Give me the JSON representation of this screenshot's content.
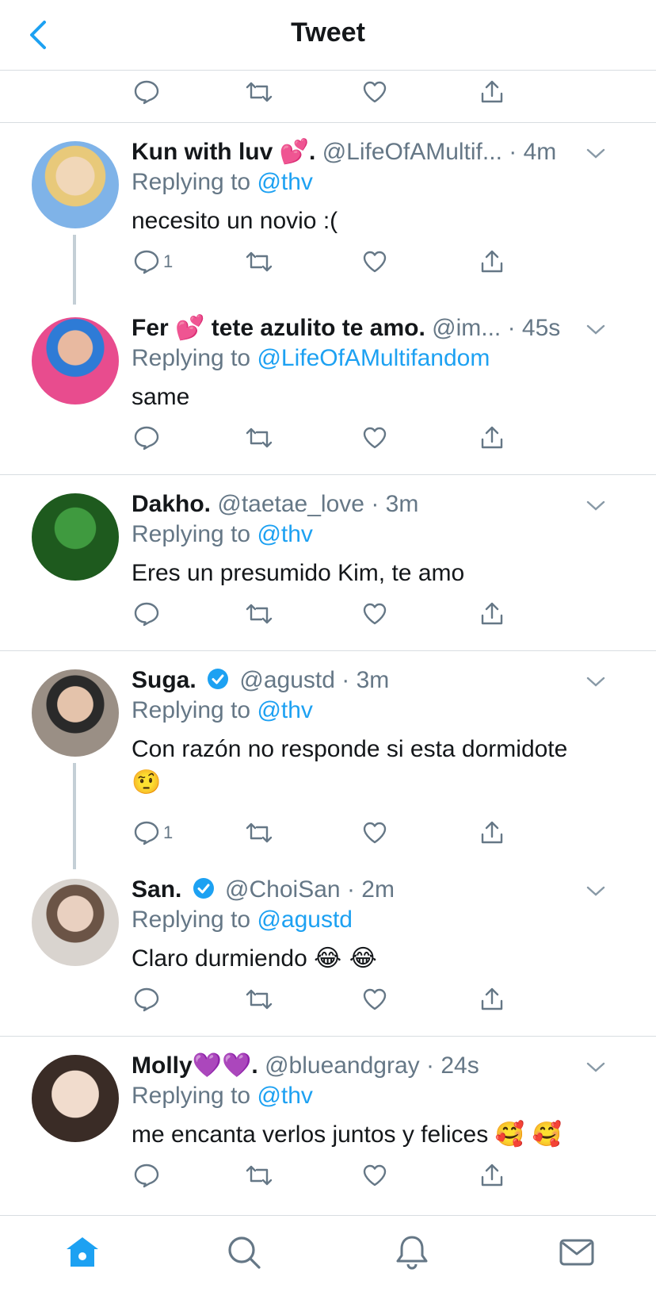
{
  "header": {
    "title": "Tweet",
    "back_icon": "chevron-left-icon"
  },
  "tweets": [
    {
      "name": "Kun with luv",
      "name_emoji": "💕",
      "name_suffix": ".",
      "handle": "@LifeOfAMultif...",
      "time": "· 4m",
      "replying_prefix": "Replying to",
      "replying_to": "@thv",
      "text": "necesito un novio :(",
      "reply_count": "1",
      "verified": false
    },
    {
      "name": "Fer",
      "name_emoji": "💕",
      "name_suffix": "tete azulito te amo.",
      "handle": "@im...",
      "time": "· 45s",
      "replying_prefix": "Replying to",
      "replying_to": "@LifeOfAMultifandom",
      "text": "same",
      "reply_count": "",
      "verified": false
    },
    {
      "name": "Dakho.",
      "handle": "@taetae_love",
      "time": "· 3m",
      "replying_prefix": "Replying to",
      "replying_to": "@thv",
      "text": "Eres un presumido Kim, te amo",
      "reply_count": "",
      "verified": false
    },
    {
      "name": "Suga.",
      "handle": "@agustd",
      "time": "· 3m",
      "replying_prefix": "Replying to",
      "replying_to": "@thv",
      "text": "Con razón no responde si esta dormidote",
      "text_emoji": "🤨",
      "reply_count": "1",
      "verified": true
    },
    {
      "name": "San.",
      "handle": "@ChoiSan",
      "time": "· 2m",
      "replying_prefix": "Replying to",
      "replying_to": "@agustd",
      "text": "Claro durmiendo",
      "text_emoji": "😂 😂",
      "reply_count": "",
      "verified": true
    },
    {
      "name": "Molly",
      "name_emoji": "💜💜",
      "name_suffix": ".",
      "handle": "@blueandgray",
      "time": "· 24s",
      "replying_prefix": "Replying to",
      "replying_to": "@thv",
      "text": "me encanta verlos juntos y felices",
      "text_emoji": "🥰 🥰",
      "reply_count": "",
      "verified": false
    }
  ],
  "colors": {
    "accent": "#1da1f2",
    "meta": "#657786",
    "text": "#14171a",
    "divider": "#d8dde1",
    "thread_line": "#c4cfd6",
    "icon": "#657786"
  },
  "bottom_nav": {
    "items": [
      "home-icon",
      "search-icon",
      "notifications-icon",
      "messages-icon"
    ]
  }
}
